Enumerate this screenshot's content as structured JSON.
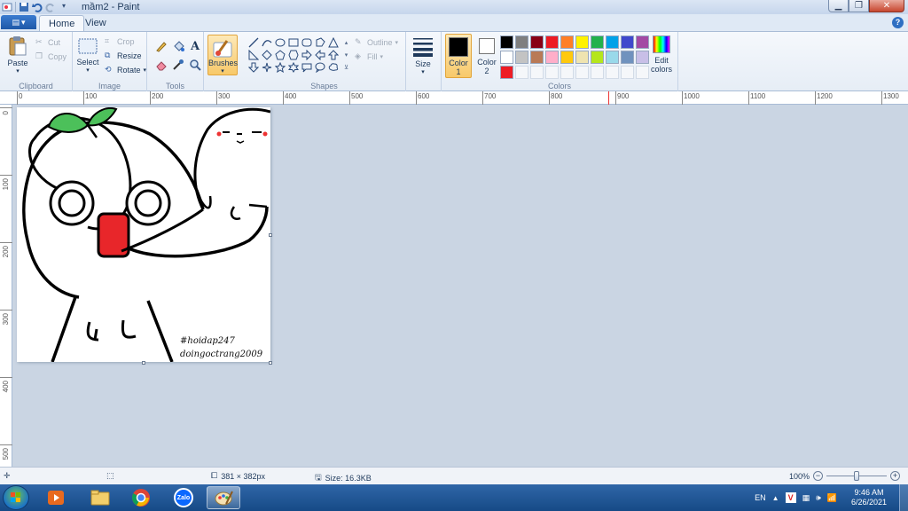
{
  "window": {
    "title": "mầm2 - Paint"
  },
  "tabs": {
    "home": "Home",
    "view": "View"
  },
  "help_symbol": "?",
  "ribbon": {
    "clipboard": {
      "label": "Clipboard",
      "paste": "Paste",
      "cut": "Cut",
      "copy": "Copy"
    },
    "image": {
      "label": "Image",
      "select": "Select",
      "crop": "Crop",
      "resize": "Resize",
      "rotate": "Rotate"
    },
    "tools": {
      "label": "Tools"
    },
    "brushes": "Brushes",
    "shapes": {
      "label": "Shapes",
      "outline": "Outline",
      "fill": "Fill"
    },
    "size": "Size",
    "colors": {
      "label": "Colors",
      "color1": "Color 1",
      "color2": "Color 2",
      "edit": "Edit colors",
      "color1_value": "#000000",
      "color2_value": "#ffffff",
      "palette": [
        "#000000",
        "#7f7f7f",
        "#880015",
        "#ed1c24",
        "#ff7f27",
        "#fff200",
        "#22b14c",
        "#00a2e8",
        "#3f48cc",
        "#a349a4",
        "#ffffff",
        "#c3c3c3",
        "#b97a57",
        "#ffaec9",
        "#ffc90e",
        "#efe4b0",
        "#b5e61d",
        "#99d9ea",
        "#7092be",
        "#c8bfe7",
        "#ed1c24",
        "",
        "",
        "",
        "",
        "",
        "",
        "",
        "",
        ""
      ]
    }
  },
  "rulers": {
    "horizontal": [
      "0",
      "100",
      "200",
      "300",
      "400",
      "500",
      "600",
      "700",
      "800",
      "900",
      "1000",
      "1100",
      "1200",
      "1300"
    ],
    "vertical": [
      "0",
      "100",
      "200",
      "300",
      "400",
      "500"
    ]
  },
  "canvas": {
    "signature_line1": "#hoidap247",
    "signature_line2": "doingoctrang2009"
  },
  "status": {
    "dimensions": "381 × 382px",
    "size": "Size: 16.3KB",
    "zoom": "100%"
  },
  "taskbar": {
    "zalo": "Zalo",
    "lang": "EN",
    "time": "9:46 AM",
    "date": "6/26/2021"
  }
}
